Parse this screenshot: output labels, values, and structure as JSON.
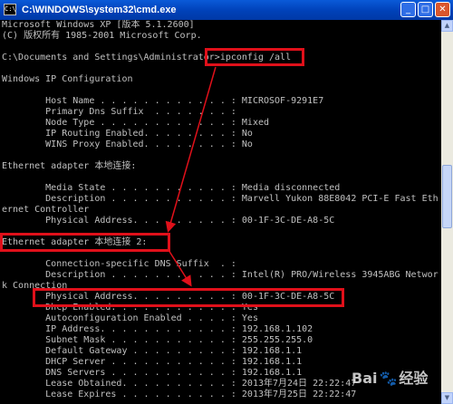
{
  "window": {
    "title": "C:\\WINDOWS\\system32\\cmd.exe",
    "icon": "cmd-icon",
    "buttons": {
      "minimize": "_",
      "maximize": "□",
      "close": "✕"
    }
  },
  "console": {
    "lines": [
      "Microsoft Windows XP [版本 5.1.2600]",
      "(C) 版权所有 1985-2001 Microsoft Corp.",
      "",
      "C:\\Documents and Settings\\Administrator>ipconfig /all",
      "",
      "Windows IP Configuration",
      "",
      "        Host Name . . . . . . . . . . . . : MICROSOF-9291E7",
      "        Primary Dns Suffix  . . . . . . . :",
      "        Node Type . . . . . . . . . . . . : Mixed",
      "        IP Routing Enabled. . . . . . . . : No",
      "        WINS Proxy Enabled. . . . . . . . : No",
      "",
      "Ethernet adapter 本地连接:",
      "",
      "        Media State . . . . . . . . . . . : Media disconnected",
      "        Description . . . . . . . . . . . : Marvell Yukon 88E8042 PCI-E Fast Eth",
      "ernet Controller",
      "        Physical Address. . . . . . . . . : 00-1F-3C-DE-A8-5C",
      "",
      "Ethernet adapter 本地连接 2:",
      "",
      "        Connection-specific DNS Suffix  . :",
      "        Description . . . . . . . . . . . : Intel(R) PRO/Wireless 3945ABG Networ",
      "k Connection",
      "        Physical Address. . . . . . . . . : 00-1F-3C-DE-A8-5C",
      "        Dhcp Enabled. . . . . . . . . . . : Yes",
      "        Autoconfiguration Enabled . . . . : Yes",
      "        IP Address. . . . . . . . . . . . : 192.168.1.102",
      "        Subnet Mask . . . . . . . . . . . : 255.255.255.0",
      "        Default Gateway . . . . . . . . . : 192.168.1.1",
      "        DHCP Server . . . . . . . . . . . : 192.168.1.1",
      "        DNS Servers . . . . . . . . . . . : 192.168.1.1",
      "        Lease Obtained. . . . . . . . . . : 2013年7月24日 22:22:47",
      "        Lease Expires . . . . . . . . . . : 2013年7月25日 22:22:47"
    ]
  },
  "watermark": {
    "left": "Bai",
    "paw": "🐾",
    "right": "经验"
  },
  "colors": {
    "highlight": "#e0101a",
    "console_text": "#c0c0c0",
    "console_bg": "#000000",
    "titlebar": "#0041b8"
  }
}
